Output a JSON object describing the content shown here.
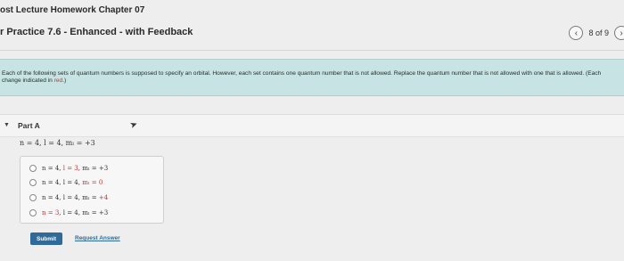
{
  "header": {
    "homework_title": "ost Lecture Homework Chapter 07",
    "practice_title": "r Practice 7.6 - Enhanced - with Feedback",
    "page_counter": "8 of 9"
  },
  "icons": {
    "prev": "chevron-left-icon",
    "next": "chevron-right-icon",
    "caret": "caret-down-icon",
    "cursor": "mouse-pointer-icon"
  },
  "instructions": {
    "main": "Each of the following sets of quantum numbers is supposed to specify an orbital. However, each set contains one quantum number that is not allowed. Replace the quantum number that is not allowed with one that is allowed. (Each change indicated in ",
    "highlight": "red",
    "end": ".)"
  },
  "part": {
    "label": "Part A",
    "given": "n = 4, l = 4, mₗ = +3"
  },
  "options": [
    {
      "parts": [
        "n = 4, ",
        "l = 3",
        ", mₗ = +3"
      ]
    },
    {
      "parts": [
        "n = 4, l = 4, ",
        "mₗ = 0",
        ""
      ]
    },
    {
      "parts": [
        "n = 4, l = 4, mₗ = ",
        "+4",
        ""
      ]
    },
    {
      "parts": [
        "",
        "n = 3",
        ", l = 4, mₗ = +3"
      ]
    }
  ],
  "buttons": {
    "submit": "Submit",
    "request_answer": "Request Answer"
  },
  "colors": {
    "banner": "#c8e3e3",
    "accent_blue": "#2f6a9b",
    "change_red": "#d03030"
  }
}
